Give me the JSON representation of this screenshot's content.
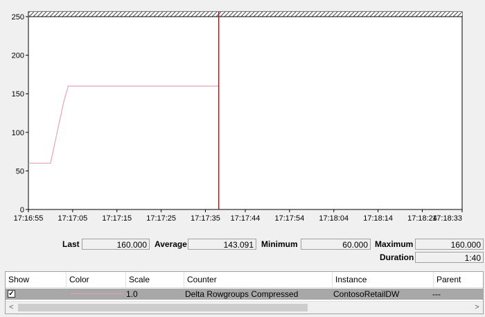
{
  "chart_data": {
    "type": "line",
    "ylim": [
      0,
      250
    ],
    "yticks": [
      "0",
      "50",
      "100",
      "150",
      "200",
      "250"
    ],
    "xticks": [
      "17:16:55",
      "17:17:05",
      "17:17:15",
      "17:17:25",
      "17:17:35",
      "17:17:44",
      "17:17:54",
      "17:18:04",
      "17:18:14",
      "17:18:24",
      "17:18:33"
    ],
    "series": [
      {
        "name": "Delta Rowgroups Compressed",
        "color": "#e8a0c0",
        "points": [
          {
            "x": "17:16:55",
            "y": 60
          },
          {
            "x": "17:17:00",
            "y": 60
          },
          {
            "x": "17:17:03",
            "y": 140
          },
          {
            "x": "17:17:04",
            "y": 160
          },
          {
            "x": "17:17:38",
            "y": 160
          }
        ]
      }
    ],
    "current_time_marker": "17:17:38",
    "marker_color": "#e00000",
    "grid": false
  },
  "stats": {
    "last_label": "Last",
    "last_value": "160.000",
    "average_label": "Average",
    "average_value": "143.091",
    "minimum_label": "Minimum",
    "minimum_value": "60.000",
    "maximum_label": "Maximum",
    "maximum_value": "160.000",
    "duration_label": "Duration",
    "duration_value": "1:40"
  },
  "legend": {
    "columns": {
      "show": "Show",
      "color": "Color",
      "scale": "Scale",
      "counter": "Counter",
      "instance": "Instance",
      "parent": "Parent"
    },
    "rows": [
      {
        "show": true,
        "color": "#e8a0c0",
        "scale": "1.0",
        "counter": "Delta Rowgroups Compressed",
        "instance": "ContosoRetailDW",
        "parent": "---"
      }
    ],
    "scroll_left": "<",
    "scroll_right": ">"
  }
}
